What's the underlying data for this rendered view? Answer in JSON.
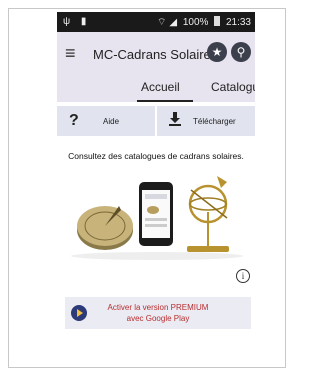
{
  "status_bar": {
    "time": "21:33",
    "battery": "100%"
  },
  "app_bar": {
    "title": "MC-Cadrans Solaires"
  },
  "tabs": [
    {
      "label": "Accueil"
    },
    {
      "label": "Catalogue"
    }
  ],
  "actions": {
    "help_icon": "?",
    "help_label": "Aide",
    "download_label": "Télécharger"
  },
  "content": {
    "subtitle": "Consultez des catalogues de cadrans solaires."
  },
  "premium": {
    "line1": "Activer la version PREMIUM",
    "line2": "avec Google Play"
  },
  "colors": {
    "app_bar_bg": "#e7e4ef",
    "button_bg": "#e1e3ee",
    "premium_text": "#b82e2e",
    "play_icon": "#2d3a78"
  }
}
